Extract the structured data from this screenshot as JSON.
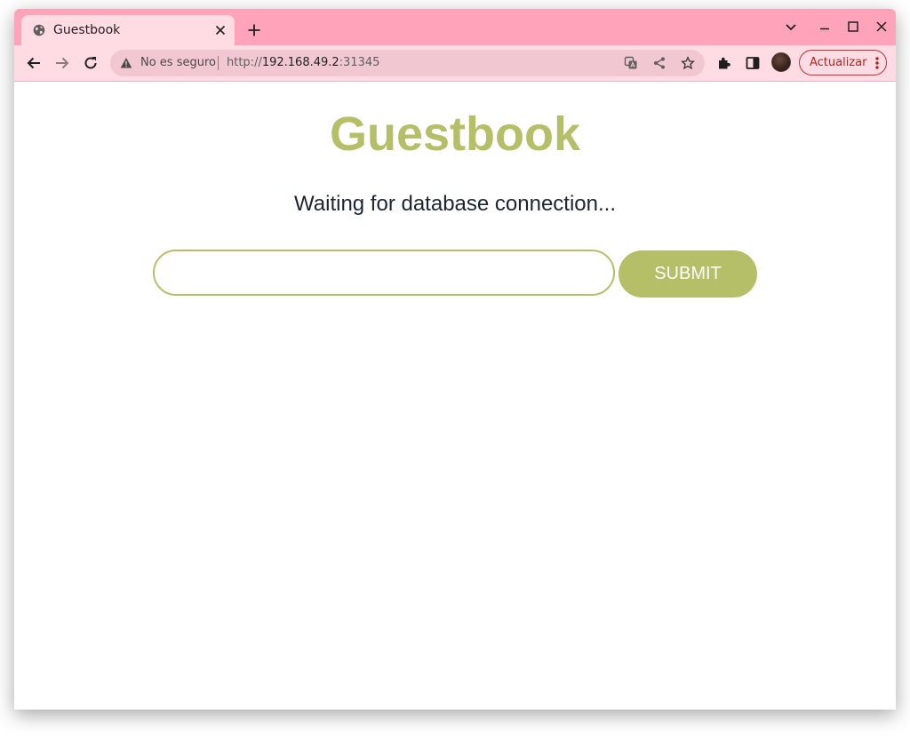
{
  "browser": {
    "tab": {
      "title": "Guestbook",
      "favicon": "globe-icon"
    },
    "address_bar": {
      "security_label": "No es seguro",
      "url_scheme": "http://",
      "url_host": "192.168.49.2",
      "url_port": ":31345"
    },
    "update_button_label": "Actualizar",
    "colors": {
      "tab_strip": "#ffa3ba",
      "toolbar": "#ffdbe4",
      "update_accent": "#c4303a"
    }
  },
  "page": {
    "title": "Guestbook",
    "status": "Waiting for database connection...",
    "entry_input": {
      "value": "",
      "placeholder": ""
    },
    "submit_label": "SUBMIT",
    "colors": {
      "accent": "#b5bf68",
      "text": "#1c2433"
    }
  }
}
